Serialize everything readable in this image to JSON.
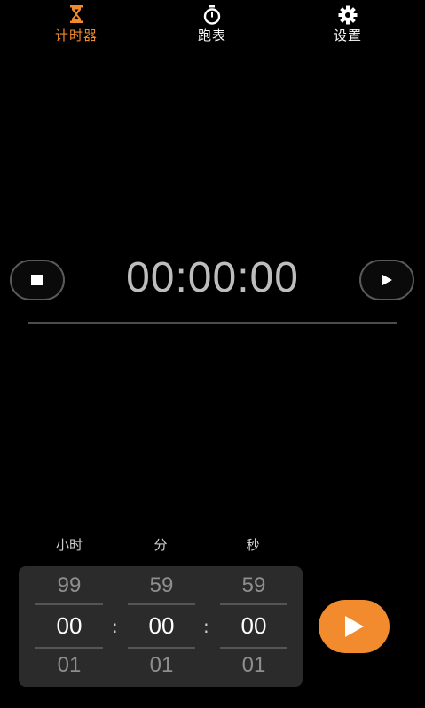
{
  "tabs": [
    {
      "label": "计时器",
      "icon": "hourglass-icon",
      "active": true
    },
    {
      "label": "跑表",
      "icon": "stopwatch-icon",
      "active": false
    },
    {
      "label": "设置",
      "icon": "gear-icon",
      "active": false
    }
  ],
  "timer": {
    "display": "00:00:00",
    "progress": 0
  },
  "picker": {
    "units": {
      "hours": "小时",
      "minutes": "分",
      "seconds": "秒"
    },
    "hours": {
      "prev": "99",
      "current": "00",
      "next": "01"
    },
    "minutes": {
      "prev": "59",
      "current": "00",
      "next": "01"
    },
    "seconds": {
      "prev": "59",
      "current": "00",
      "next": "01"
    },
    "separator": ":"
  },
  "colors": {
    "accent": "#f28a2e",
    "background": "#000000",
    "panel": "#2b2b2b"
  }
}
